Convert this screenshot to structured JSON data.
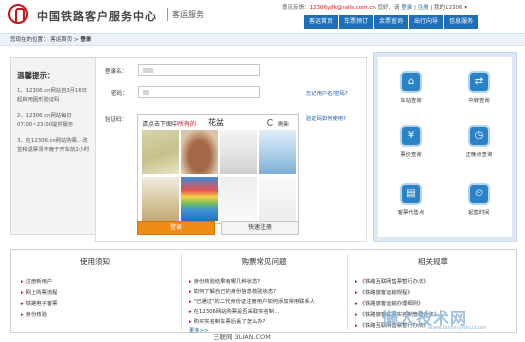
{
  "header": {
    "site_name": "中国铁路客户服务中心",
    "sub_title": "客运服务",
    "feedback_label": "意见反馈：",
    "feedback_email": "12306yjfk@rails.com.cn",
    "greeting": "您好，请",
    "login_link": "登录",
    "register_link": "注册",
    "my_account": "我的12306 ▾"
  },
  "nav": {
    "items": [
      "客运首页",
      "车票预订",
      "余票查询",
      "出行向导",
      "信息服务"
    ]
  },
  "breadcrumb": {
    "prefix": "您现在的位置：",
    "home": "客运首页",
    "sep": ">",
    "current": "登录"
  },
  "tips": {
    "title": "温馨提示：",
    "items": [
      "1、12306.cn网站自3月16日起启用图形验证码",
      "2、12306.cn网站每日07:00~23:00提供服务",
      "3、在12306.cn网站购票、改签和退票须不晚于开车前2小时"
    ]
  },
  "login": {
    "username_label": "登录名：",
    "password_label": "密码：",
    "captcha_label": "验证码：",
    "forgot_link": "忘记用户名/密码?",
    "captcha_help_link": "验证码如何使用?",
    "captcha_prompt_prefix": "请点击下图中",
    "captcha_prompt_highlight": "所有的",
    "captcha_word": "花盆",
    "refresh_label": "刷新",
    "login_button": "登录",
    "register_button": "快速注册"
  },
  "services": [
    {
      "label": "车站查询",
      "icon": "station-icon"
    },
    {
      "label": "中转查询",
      "icon": "transfer-icon"
    },
    {
      "label": "票价查询",
      "icon": "price-icon"
    },
    {
      "label": "正晚点查询",
      "icon": "delay-icon"
    },
    {
      "label": "客票代售点",
      "icon": "agency-icon"
    },
    {
      "label": "起售时间",
      "icon": "time-icon"
    }
  ],
  "bottom": {
    "guide": {
      "title": "使用须知",
      "items": [
        "注册新用户",
        "网上购票流程",
        "铁路电子客票",
        "身份核验"
      ]
    },
    "faq": {
      "title": "购票常见问题",
      "items": [
        "身份核验结果有哪几种状态?",
        "如何了解自己的身份信息核验状态?",
        "\"已通过\"的二代身份证注册用户如何添加常用联系人",
        "在12306网站购票是否采取实名制...",
        "购买实名制车票后丢了怎么办?"
      ],
      "more": "更多>>"
    },
    "rules": {
      "title": "相关规章",
      "items": [
        "《铁路互联网售票暂行办法》",
        "《铁路旅客运输规程》",
        "《铁路旅客运输办理细则》",
        "《铁路旅客车票实名制管理办法》",
        "《铁路互联网售票暂行办法》"
      ]
    }
  },
  "watermarks": {
    "left": "三联网 3LIAN.COM",
    "right": "懒人技术网",
    "url": "www.lanrenjishu.com"
  },
  "colors": {
    "brand_red": "#c8161d",
    "nav_blue": "#1e6fb9",
    "login_orange": "#f18b18",
    "link_blue": "#1a5fa8"
  }
}
